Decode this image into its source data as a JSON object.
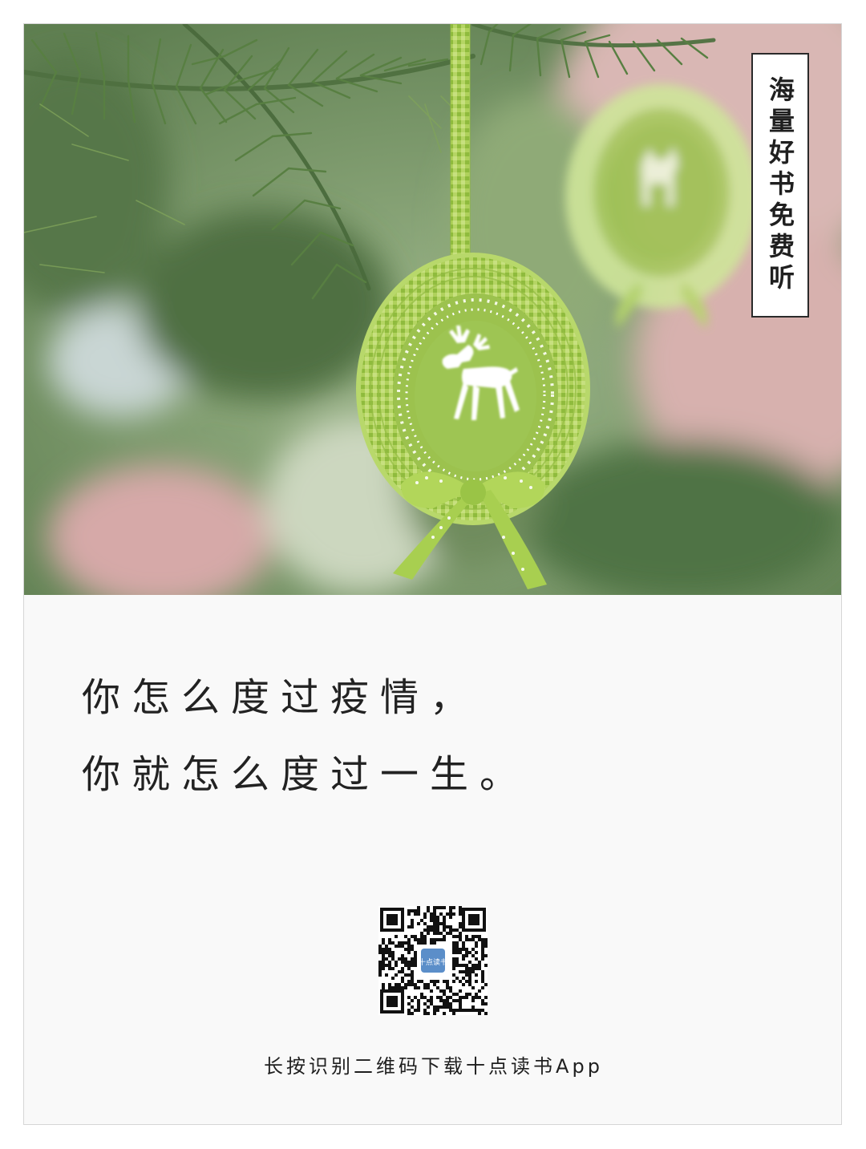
{
  "badge": {
    "text": "海量好书免费听"
  },
  "quote": {
    "line1": "你怎么度过疫情，",
    "line2": "你就怎么度过一生。"
  },
  "qr": {
    "logo_text": "十点读书"
  },
  "caption": "长按识别二维码下载十点读书App",
  "colors": {
    "background": "#f9f9f9",
    "ornament_green": "#a8cf55",
    "text": "#222222"
  },
  "photo": {
    "subject": "green gingham Christmas ornament with white reindeer on a pine tree"
  }
}
